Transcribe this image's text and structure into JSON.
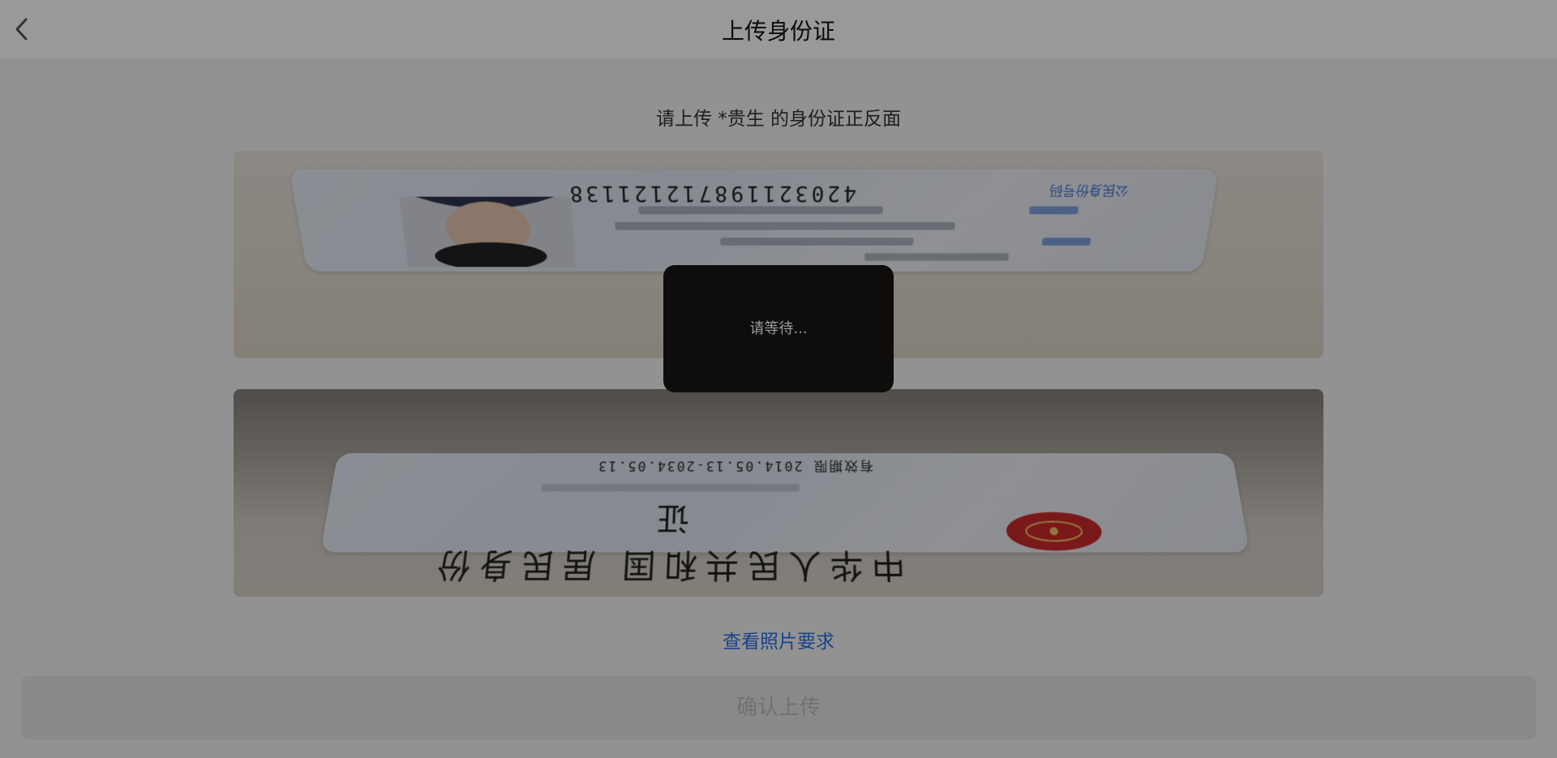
{
  "header": {
    "title": "上传身份证"
  },
  "prompt": "请上传 *贵生 的身份证正反面",
  "front_photo": {
    "id_label": "公民身份号码",
    "id_number": "420321198712121138"
  },
  "back_photo": {
    "title": "中华人民共和国 居民身份证",
    "validity": "有效期限 2014.05.13-2034.05.13",
    "emblem_color": "#cc2a2a"
  },
  "photo_requirements_link": "查看照片要求",
  "confirm_button": "确认上传",
  "toast": {
    "text": "请等待..."
  },
  "colors": {
    "accent_link": "#2b6fe8",
    "disabled_button": "#e4e4e4",
    "toast_bg": "#0e0d0c"
  }
}
